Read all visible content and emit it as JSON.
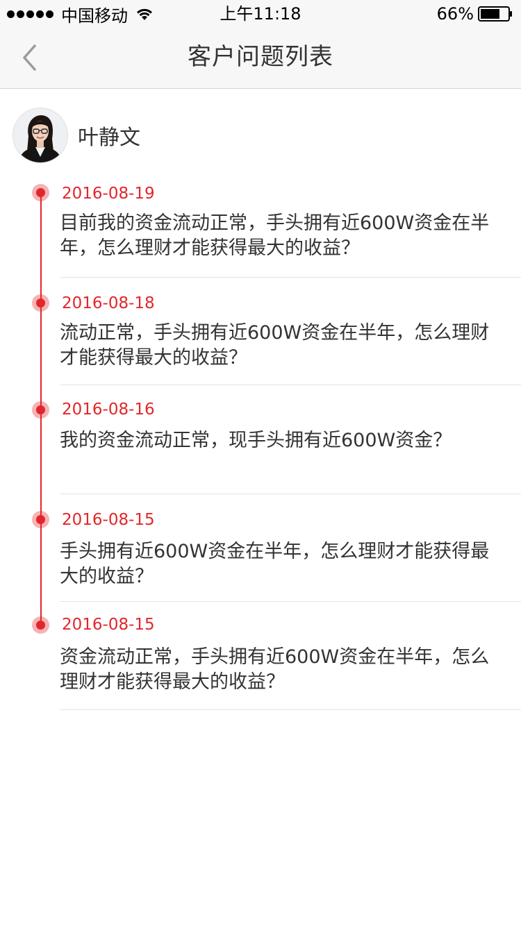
{
  "status_bar": {
    "carrier": "中国移动",
    "time": "上午11:18",
    "battery": "66%"
  },
  "nav": {
    "title": "客户问题列表",
    "back_icon": "chevron-left-icon"
  },
  "profile": {
    "name": "叶静文",
    "avatar_icon": "avatar-photo"
  },
  "colors": {
    "accent": "#e2262b",
    "text": "#333333",
    "divider": "#e3e3e3"
  },
  "questions": [
    {
      "date": "2016-08-19",
      "text": "目前我的资金流动正常，手头拥有近600W资金在半年，怎么理财才能获得最大的收益？"
    },
    {
      "date": "2016-08-18",
      "text": "流动正常，手头拥有近600W资金在半年，怎么理财才能获得最大的收益？"
    },
    {
      "date": "2016-08-16",
      "text": "我的资金流动正常，现手头拥有近600W资金？"
    },
    {
      "date": "2016-08-15",
      "text": "手头拥有近600W资金在半年，怎么理财才能获得最大的收益？"
    },
    {
      "date": "2016-08-15",
      "text": "资金流动正常，手头拥有近600W资金在半年，怎么理财才能获得最大的收益？"
    }
  ]
}
